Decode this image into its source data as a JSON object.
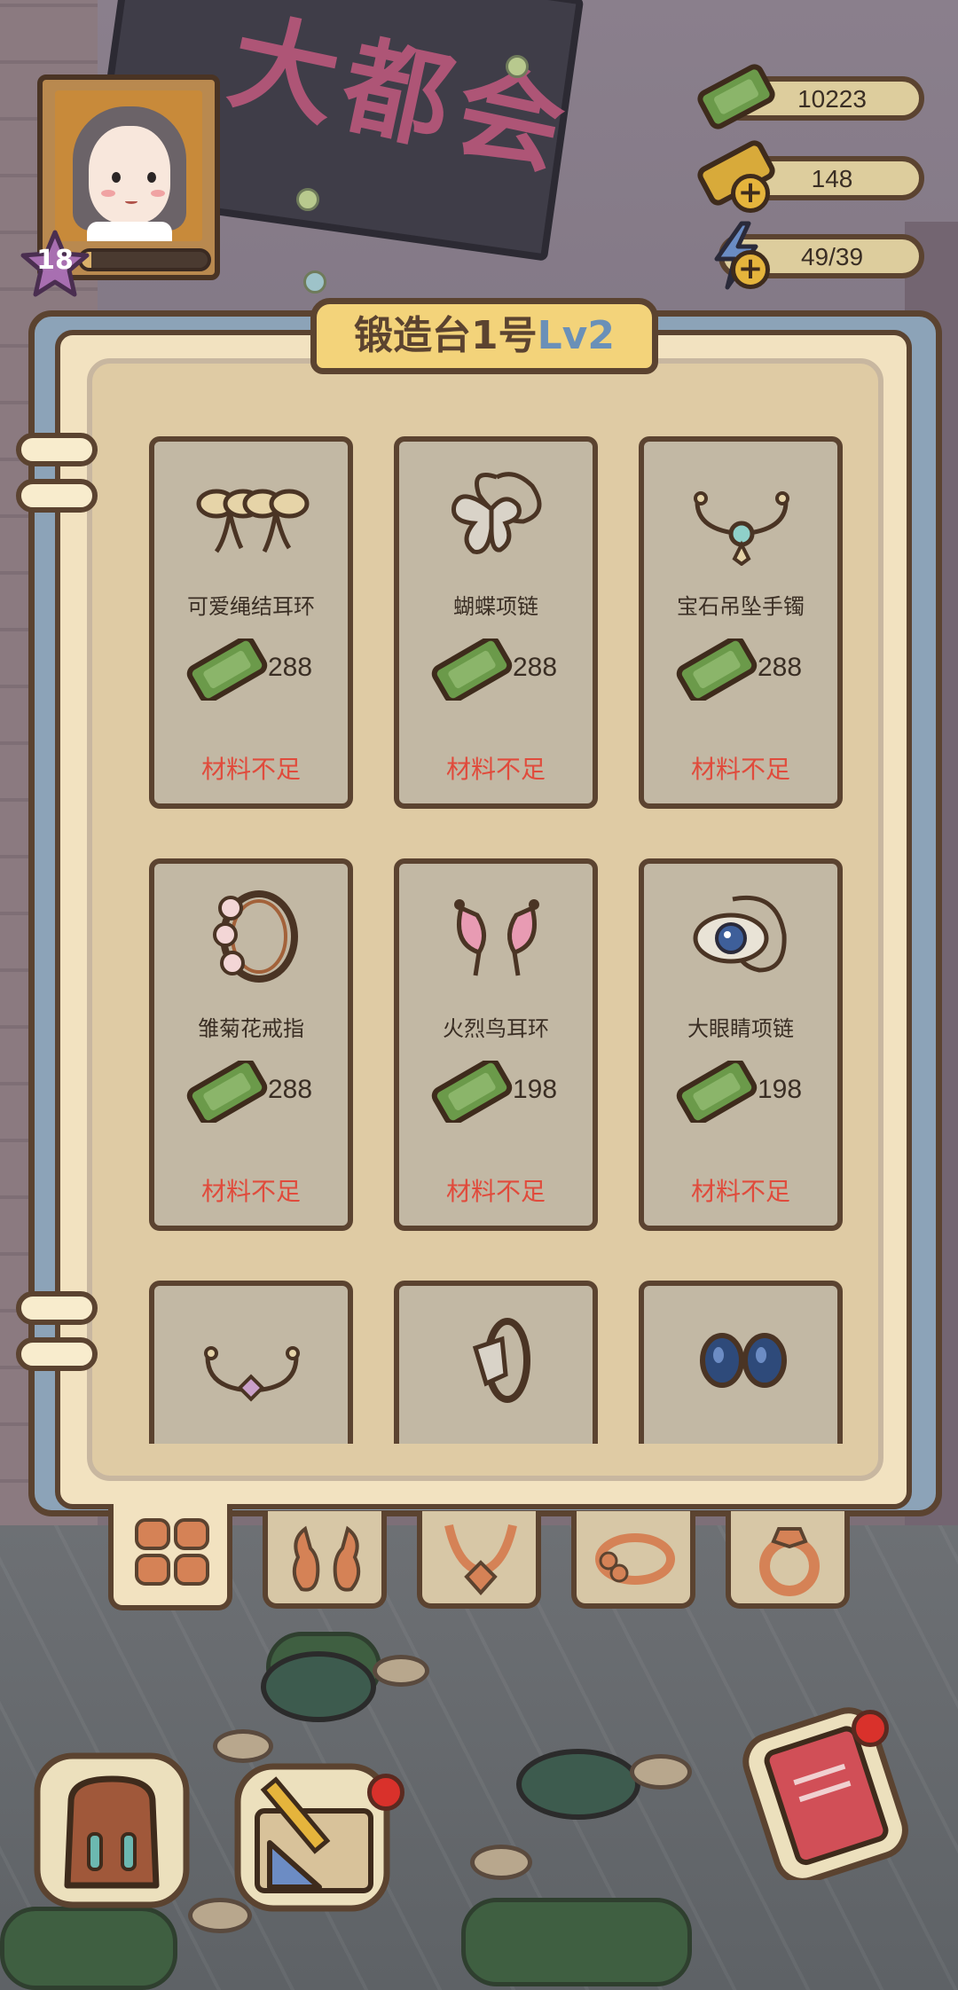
{
  "hud": {
    "level": "18",
    "xp_progress": 0.08,
    "resources": [
      {
        "icon": "cash-icon",
        "value": "10223",
        "has_plus": false
      },
      {
        "icon": "gold-ticket-icon",
        "value": "148",
        "has_plus": true
      },
      {
        "icon": "energy-bolt-icon",
        "value": "49/39",
        "has_plus": true
      }
    ]
  },
  "background": {
    "sign_text": "大都会"
  },
  "panel": {
    "title": "锻造台1号",
    "level_label": "Lv2",
    "items": [
      {
        "name": "可爱绳结耳环",
        "cost": "288",
        "status": "材料不足",
        "icon": "bow-earrings-icon"
      },
      {
        "name": "蝴蝶项链",
        "cost": "288",
        "status": "材料不足",
        "icon": "butterfly-necklace-icon"
      },
      {
        "name": "宝石吊坠手镯",
        "cost": "288",
        "status": "材料不足",
        "icon": "gem-pendant-bracelet-icon"
      },
      {
        "name": "雏菊花戒指",
        "cost": "288",
        "status": "材料不足",
        "icon": "daisy-ring-icon"
      },
      {
        "name": "火烈鸟耳环",
        "cost": "198",
        "status": "材料不足",
        "icon": "flamingo-earrings-icon"
      },
      {
        "name": "大眼睛项链",
        "cost": "198",
        "status": "材料不足",
        "icon": "big-eye-necklace-icon"
      },
      {
        "name": "",
        "cost": "",
        "status": "",
        "icon": "cuff-bracelet-icon"
      },
      {
        "name": "",
        "cost": "",
        "status": "",
        "icon": "diamond-ring-icon"
      },
      {
        "name": "",
        "cost": "",
        "status": "",
        "icon": "blue-stud-earrings-icon"
      }
    ],
    "categories": [
      {
        "icon": "all-grid-icon",
        "active": true
      },
      {
        "icon": "earrings-icon",
        "active": false
      },
      {
        "icon": "necklace-icon",
        "active": false
      },
      {
        "icon": "bracelet-icon",
        "active": false
      },
      {
        "icon": "ring-icon",
        "active": false
      }
    ]
  },
  "colors": {
    "panel_bg": "#f2e2c0",
    "card_bg": "#c2b8a4",
    "outline": "#5b4330",
    "title_badge": "#f3d37a",
    "level_blue": "#6a90b8",
    "warning_red": "#e04b3c",
    "cash_green": "#6b9a4a"
  }
}
